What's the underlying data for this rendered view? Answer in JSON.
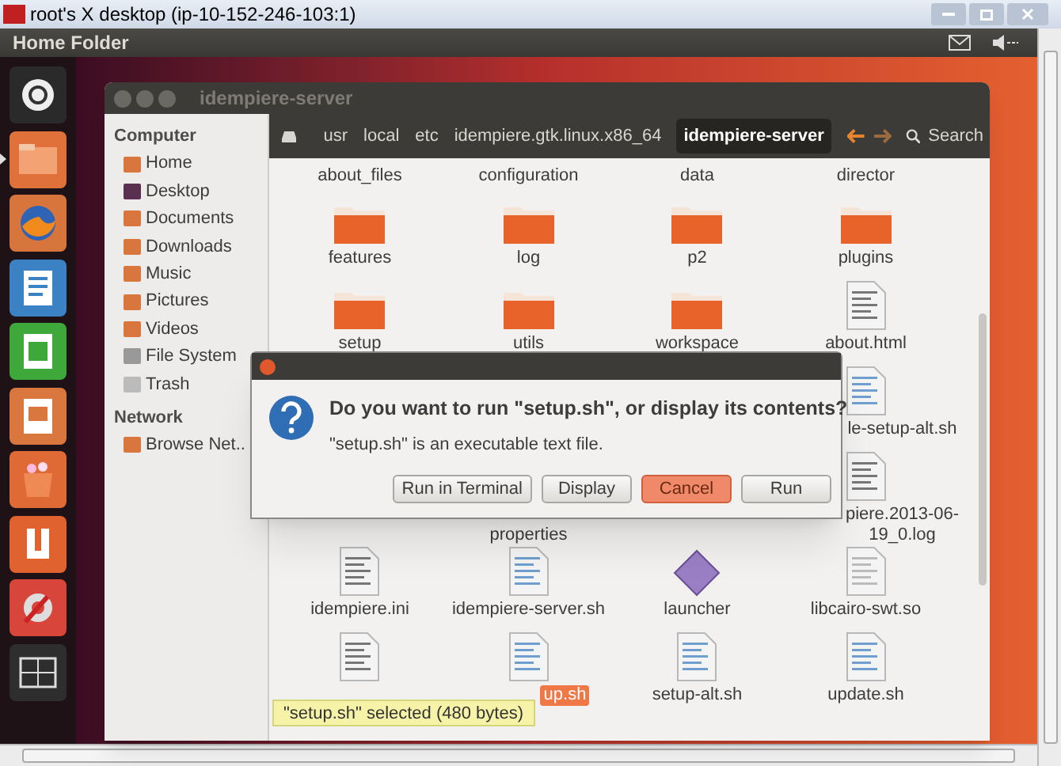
{
  "vnc_window": {
    "title": "root's X desktop (ip-10-152-246-103:1)"
  },
  "top_panel": {
    "title": "Home Folder"
  },
  "launcher": [
    {
      "kind": "dash",
      "running": false
    },
    {
      "kind": "files",
      "running": true
    },
    {
      "kind": "browser",
      "running": false
    },
    {
      "kind": "writer",
      "running": false
    },
    {
      "kind": "calc",
      "running": false
    },
    {
      "kind": "impress",
      "running": false
    },
    {
      "kind": "software",
      "running": false
    },
    {
      "kind": "cloud",
      "running": false
    },
    {
      "kind": "settings",
      "running": false
    },
    {
      "kind": "workspaces",
      "running": false
    }
  ],
  "file_window": {
    "title": "idempiere-server",
    "sidebar": [
      {
        "heading": "Computer",
        "items": [
          {
            "label": "Home",
            "kind": "home"
          },
          {
            "label": "Desktop",
            "kind": "desktop"
          },
          {
            "label": "Documents",
            "kind": "documents"
          },
          {
            "label": "Downloads",
            "kind": "downloads"
          },
          {
            "label": "Music",
            "kind": "music"
          },
          {
            "label": "Pictures",
            "kind": "pictures"
          },
          {
            "label": "Videos",
            "kind": "videos"
          },
          {
            "label": "File System",
            "kind": "drive"
          },
          {
            "label": "Trash",
            "kind": "trash"
          }
        ]
      },
      {
        "heading": "Network",
        "items": [
          {
            "label": "Browse Net..",
            "kind": "network"
          }
        ]
      }
    ],
    "path": [
      {
        "label": "usr",
        "selected": false
      },
      {
        "label": "local",
        "selected": false
      },
      {
        "label": "etc",
        "selected": false
      },
      {
        "label": "idempiere.gtk.linux.x86_64",
        "selected": false
      },
      {
        "label": "idempiere-server",
        "selected": true
      }
    ],
    "search": "Search",
    "files": [
      [
        {
          "kind": "none",
          "label": "about_files",
          "selected": false
        },
        {
          "kind": "none",
          "label": "configuration",
          "selected": false
        },
        {
          "kind": "none",
          "label": "data",
          "selected": false
        },
        {
          "kind": "none",
          "label": "director",
          "selected": false
        }
      ],
      [
        {
          "kind": "folder",
          "label": "features",
          "selected": false
        },
        {
          "kind": "folder",
          "label": "log",
          "selected": false
        },
        {
          "kind": "folder",
          "label": "p2",
          "selected": false
        },
        {
          "kind": "folder",
          "label": "plugins",
          "selected": false
        }
      ],
      [
        {
          "kind": "folder",
          "label": "setup",
          "selected": false
        },
        {
          "kind": "folder",
          "label": "utils",
          "selected": false
        },
        {
          "kind": "folder",
          "label": "workspace",
          "selected": false
        },
        {
          "kind": "text",
          "label": "about.html",
          "selected": false
        }
      ],
      [
        {
          "kind": "none"
        },
        {
          "kind": "none"
        },
        {
          "kind": "none"
        },
        {
          "kind": "script",
          "label": "le-setup-alt.sh",
          "selected": false
        }
      ],
      [
        {
          "kind": "none"
        },
        {
          "kind": "none",
          "label": "properties",
          "selected": false
        },
        {
          "kind": "none"
        },
        {
          "kind": "text",
          "label": "piere.2013-06-19_0.log",
          "selected": false
        }
      ],
      [
        {
          "kind": "text",
          "label": "idempiere.ini",
          "selected": false
        },
        {
          "kind": "script",
          "label": "idempiere-server.sh",
          "selected": false
        },
        {
          "kind": "diamond",
          "label": "launcher",
          "selected": false
        },
        {
          "kind": "plain",
          "label": "libcairo-swt.so",
          "selected": false
        }
      ],
      [
        {
          "kind": "text",
          "selected": false
        },
        {
          "kind": "script",
          "label": "up.sh",
          "selected": true
        },
        {
          "kind": "script",
          "label": "setup-alt.sh",
          "selected": false
        },
        {
          "kind": "script",
          "label": "update.sh",
          "selected": false
        }
      ]
    ],
    "status": "\"setup.sh\" selected (480 bytes)"
  },
  "dialog": {
    "question": "Do you want to run \"setup.sh\", or display its contents?",
    "message": "\"setup.sh\" is an executable text file.",
    "buttons": [
      {
        "label": "Run in Terminal",
        "selected": false
      },
      {
        "label": "Display",
        "selected": false
      },
      {
        "label": "Cancel",
        "selected": true
      },
      {
        "label": "Run",
        "selected": false
      }
    ]
  }
}
